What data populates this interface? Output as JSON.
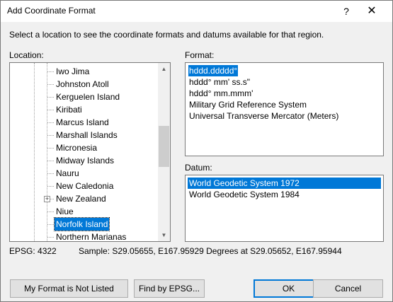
{
  "window": {
    "title": "Add Coordinate Format",
    "help_glyph": "?",
    "close_glyph": "✕"
  },
  "instruction": "Select a location to see the coordinate formats and datums available for that region.",
  "location": {
    "label": "Location:",
    "selected": "Norfolk Island",
    "items": [
      {
        "label": "Iwo Jima",
        "expandable": false
      },
      {
        "label": "Johnston Atoll",
        "expandable": false
      },
      {
        "label": "Kerguelen Island",
        "expandable": false
      },
      {
        "label": "Kiribati",
        "expandable": false
      },
      {
        "label": "Marcus Island",
        "expandable": false
      },
      {
        "label": "Marshall Islands",
        "expandable": false
      },
      {
        "label": "Micronesia",
        "expandable": false
      },
      {
        "label": "Midway Islands",
        "expandable": false
      },
      {
        "label": "Nauru",
        "expandable": false
      },
      {
        "label": "New Caledonia",
        "expandable": false
      },
      {
        "label": "New Zealand",
        "expandable": true
      },
      {
        "label": "Niue",
        "expandable": false
      },
      {
        "label": "Norfolk Island",
        "expandable": false
      },
      {
        "label": "Northern Marianas",
        "expandable": false
      }
    ]
  },
  "format": {
    "label": "Format:",
    "selected": "hddd.ddddd°",
    "options": [
      "hddd.ddddd°",
      "hddd° mm' ss.s\"",
      "hddd° mm.mmm'",
      "Military Grid Reference System",
      "Universal Transverse Mercator (Meters)"
    ]
  },
  "datum": {
    "label": "Datum:",
    "selected": "World Geodetic System 1972",
    "options": [
      "World Geodetic System 1972",
      "World Geodetic System 1984"
    ]
  },
  "info": {
    "epsg": "EPSG: 4322",
    "sample": "Sample: S29.05655, E167.95929 Degrees at S29.05652, E167.95944"
  },
  "buttons": {
    "not_listed": "My Format is Not Listed",
    "find_epsg": "Find by EPSG...",
    "ok": "OK",
    "cancel": "Cancel"
  }
}
